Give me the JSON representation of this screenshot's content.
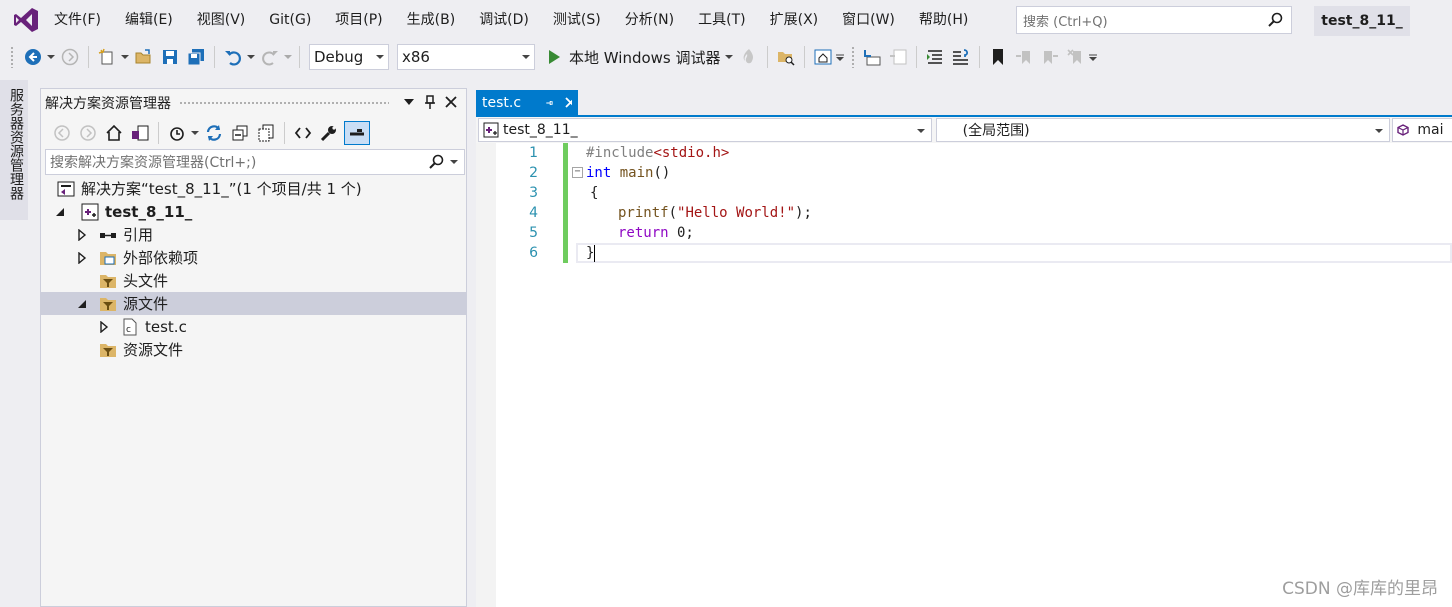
{
  "menubar": {
    "items": [
      "文件(F)",
      "编辑(E)",
      "视图(V)",
      "Git(G)",
      "项目(P)",
      "生成(B)",
      "调试(D)",
      "测试(S)",
      "分析(N)",
      "工具(T)",
      "扩展(X)",
      "窗口(W)",
      "帮助(H)"
    ],
    "search_placeholder": "搜索 (Ctrl+Q)",
    "solution_name": "test_8_11_"
  },
  "toolbar": {
    "config": "Debug",
    "platform": "x86",
    "run_label": "本地 Windows 调试器"
  },
  "side_tab": {
    "label": "服务器资源管理器"
  },
  "solution_explorer": {
    "title": "解决方案资源管理器",
    "search_placeholder": "搜索解决方案资源管理器(Ctrl+;)",
    "tree": {
      "solution": "解决方案“test_8_11_”(1 个项目/共 1 个)",
      "project": "test_8_11_",
      "references": "引用",
      "external_deps": "外部依赖项",
      "header_files": "头文件",
      "source_files": "源文件",
      "test_c": "test.c",
      "resource_files": "资源文件"
    }
  },
  "editor": {
    "tab_label": "test.c",
    "nav_project": "test_8_11_",
    "nav_scope": "(全局范围)",
    "nav_member": "mai",
    "line_numbers": [
      "1",
      "2",
      "3",
      "4",
      "5",
      "6"
    ],
    "code": {
      "l1_directive": "#include",
      "l1_header": "<stdio.h>",
      "l2_kw": "int",
      "l2_name": "main",
      "l2_rest": "()",
      "l3": "{",
      "l4_fn": "printf",
      "l4_open": "(",
      "l4_str": "\"Hello World!\"",
      "l4_close": ");",
      "l5_kw": "return",
      "l5_rest": " 0;",
      "l6": "}"
    }
  },
  "watermark": "CSDN @库库的里昂",
  "colors": {
    "accent": "#007acc",
    "vs_purple": "#68217a",
    "change_bar": "#6fcc5e",
    "line_number": "#2b91af"
  }
}
